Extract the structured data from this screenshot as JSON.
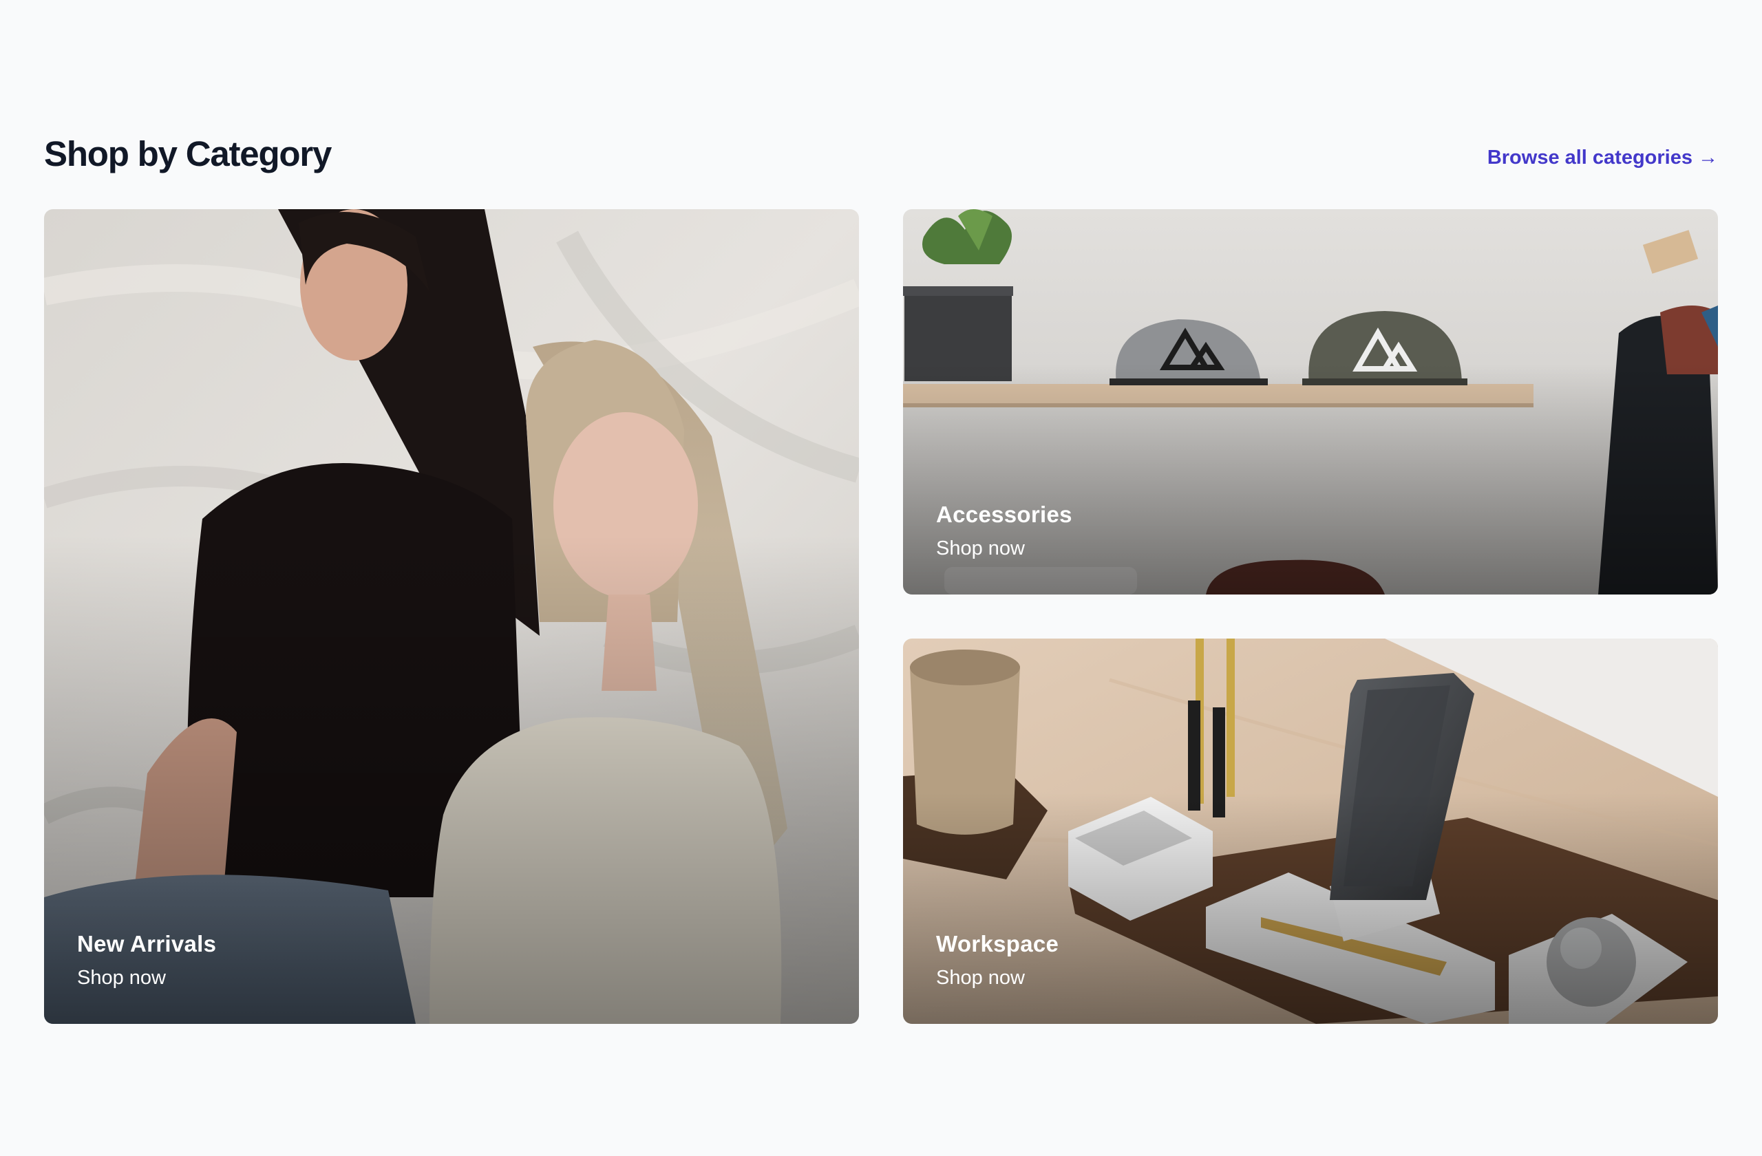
{
  "section": {
    "title": "Shop by Category",
    "browse_link": {
      "label": "Browse all categories",
      "icon": "arrow-right-icon"
    }
  },
  "categories": [
    {
      "name": "New Arrivals",
      "cta": "Shop now",
      "image": "two-women-tshirts-photo"
    },
    {
      "name": "Accessories",
      "cta": "Shop now",
      "image": "caps-on-shelf-photo"
    },
    {
      "name": "Workspace",
      "cta": "Shop now",
      "image": "desk-organizer-photo"
    }
  ],
  "colors": {
    "page_background": "#f9fafb",
    "heading": "#111827",
    "accent_link": "#4338ca",
    "caption_text": "#ffffff"
  }
}
